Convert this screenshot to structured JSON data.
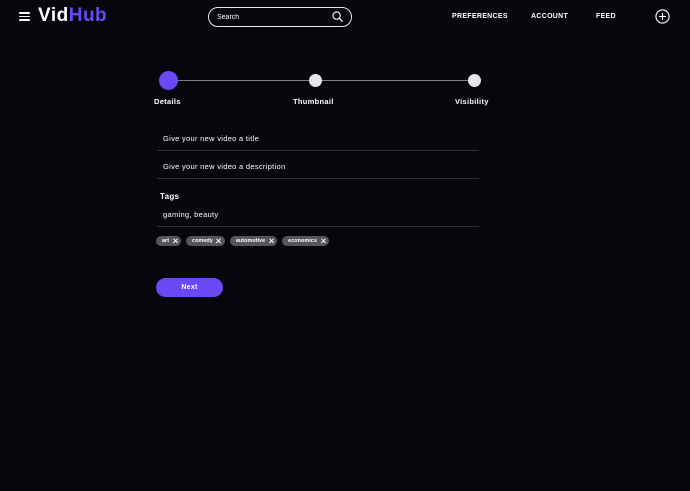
{
  "brand": {
    "logo_first": "Vid",
    "logo_second": "Hub"
  },
  "header": {
    "menu_icon": "hamburger-menu-icon",
    "search": {
      "placeholder": "Search",
      "value": "",
      "icon": "search-icon"
    },
    "nav": [
      {
        "label": "PREFERENCES"
      },
      {
        "label": "ACCOUNT"
      },
      {
        "label": "FEED"
      }
    ],
    "add_icon": "plus-circle-icon"
  },
  "stepper": {
    "steps": [
      {
        "label": "Details",
        "active": true
      },
      {
        "label": "Thumbnail",
        "active": false
      },
      {
        "label": "Visibility",
        "active": false
      }
    ]
  },
  "form": {
    "title_placeholder": "Give your new video a title",
    "title_value": "",
    "description_placeholder": "Give your new video a description",
    "description_value": "",
    "tags_label": "Tags",
    "tags_value": "gaming, beauty",
    "tags": [
      {
        "label": "art"
      },
      {
        "label": "comedy"
      },
      {
        "label": "automotive"
      },
      {
        "label": "economics"
      }
    ],
    "next_label": "Next"
  },
  "colors": {
    "background": "#07060c",
    "accent": "#6a48f5",
    "chip": "#55555c",
    "inactive_step": "#e6e6e6"
  }
}
